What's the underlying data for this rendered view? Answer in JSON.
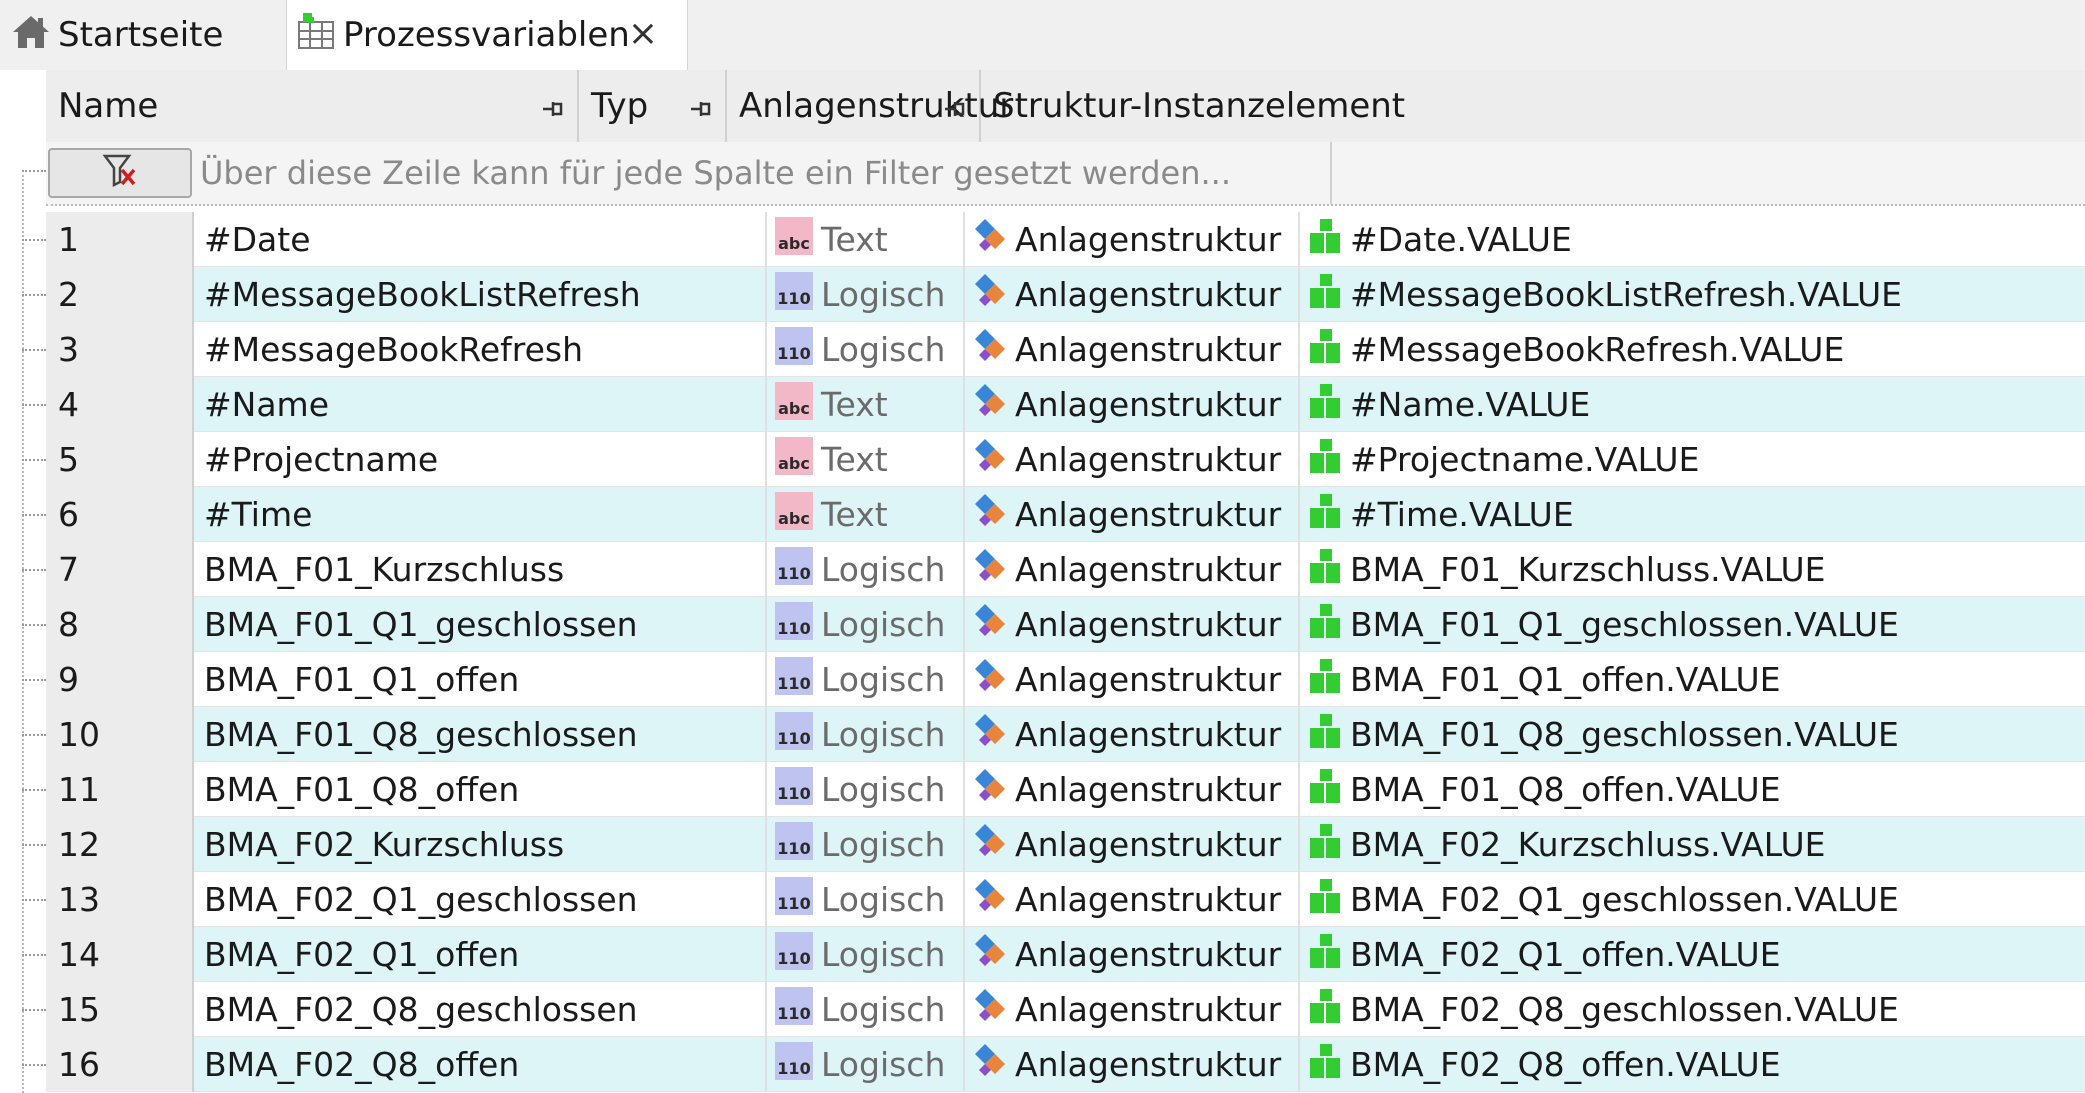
{
  "tabs": {
    "home_label": "Startseite",
    "active_label": "Prozessvariablen",
    "close_glyph": "×"
  },
  "columns": {
    "name": "Name",
    "typ": "Typ",
    "anlagenstruktur": "Anlagenstruktur",
    "struktur_instanzelement": "Struktur-Instanzelement"
  },
  "filter": {
    "placeholder": "Über diese Zeile kann für jede Spalte ein Filter gesetzt werden..."
  },
  "type_icons": {
    "text": "abc",
    "logisch": "110"
  },
  "colors": {
    "row_alt": "#ddf5f7",
    "text_icon": "#f2b8c8",
    "bool_icon": "#bfc3ef",
    "instance_icon": "#33cc33"
  },
  "rows": [
    {
      "num": "1",
      "name": "#Date",
      "type_kind": "text",
      "typ": "Text",
      "anlage": "Anlagenstruktur",
      "instanz": "#Date.VALUE"
    },
    {
      "num": "2",
      "name": "#MessageBookListRefresh",
      "type_kind": "logisch",
      "typ": "Logisch",
      "anlage": "Anlagenstruktur",
      "instanz": "#MessageBookListRefresh.VALUE"
    },
    {
      "num": "3",
      "name": "#MessageBookRefresh",
      "type_kind": "logisch",
      "typ": "Logisch",
      "anlage": "Anlagenstruktur",
      "instanz": "#MessageBookRefresh.VALUE"
    },
    {
      "num": "4",
      "name": "#Name",
      "type_kind": "text",
      "typ": "Text",
      "anlage": "Anlagenstruktur",
      "instanz": "#Name.VALUE"
    },
    {
      "num": "5",
      "name": "#Projectname",
      "type_kind": "text",
      "typ": "Text",
      "anlage": "Anlagenstruktur",
      "instanz": "#Projectname.VALUE"
    },
    {
      "num": "6",
      "name": "#Time",
      "type_kind": "text",
      "typ": "Text",
      "anlage": "Anlagenstruktur",
      "instanz": "#Time.VALUE"
    },
    {
      "num": "7",
      "name": "BMA_F01_Kurzschluss",
      "type_kind": "logisch",
      "typ": "Logisch",
      "anlage": "Anlagenstruktur",
      "instanz": "BMA_F01_Kurzschluss.VALUE"
    },
    {
      "num": "8",
      "name": "BMA_F01_Q1_geschlossen",
      "type_kind": "logisch",
      "typ": "Logisch",
      "anlage": "Anlagenstruktur",
      "instanz": "BMA_F01_Q1_geschlossen.VALUE"
    },
    {
      "num": "9",
      "name": "BMA_F01_Q1_offen",
      "type_kind": "logisch",
      "typ": "Logisch",
      "anlage": "Anlagenstruktur",
      "instanz": "BMA_F01_Q1_offen.VALUE"
    },
    {
      "num": "10",
      "name": "BMA_F01_Q8_geschlossen",
      "type_kind": "logisch",
      "typ": "Logisch",
      "anlage": "Anlagenstruktur",
      "instanz": "BMA_F01_Q8_geschlossen.VALUE"
    },
    {
      "num": "11",
      "name": "BMA_F01_Q8_offen",
      "type_kind": "logisch",
      "typ": "Logisch",
      "anlage": "Anlagenstruktur",
      "instanz": "BMA_F01_Q8_offen.VALUE"
    },
    {
      "num": "12",
      "name": "BMA_F02_Kurzschluss",
      "type_kind": "logisch",
      "typ": "Logisch",
      "anlage": "Anlagenstruktur",
      "instanz": "BMA_F02_Kurzschluss.VALUE"
    },
    {
      "num": "13",
      "name": "BMA_F02_Q1_geschlossen",
      "type_kind": "logisch",
      "typ": "Logisch",
      "anlage": "Anlagenstruktur",
      "instanz": "BMA_F02_Q1_geschlossen.VALUE"
    },
    {
      "num": "14",
      "name": "BMA_F02_Q1_offen",
      "type_kind": "logisch",
      "typ": "Logisch",
      "anlage": "Anlagenstruktur",
      "instanz": "BMA_F02_Q1_offen.VALUE"
    },
    {
      "num": "15",
      "name": "BMA_F02_Q8_geschlossen",
      "type_kind": "logisch",
      "typ": "Logisch",
      "anlage": "Anlagenstruktur",
      "instanz": "BMA_F02_Q8_geschlossen.VALUE"
    },
    {
      "num": "16",
      "name": "BMA_F02_Q8_offen",
      "type_kind": "logisch",
      "typ": "Logisch",
      "anlage": "Anlagenstruktur",
      "instanz": "BMA_F02_Q8_offen.VALUE"
    }
  ]
}
